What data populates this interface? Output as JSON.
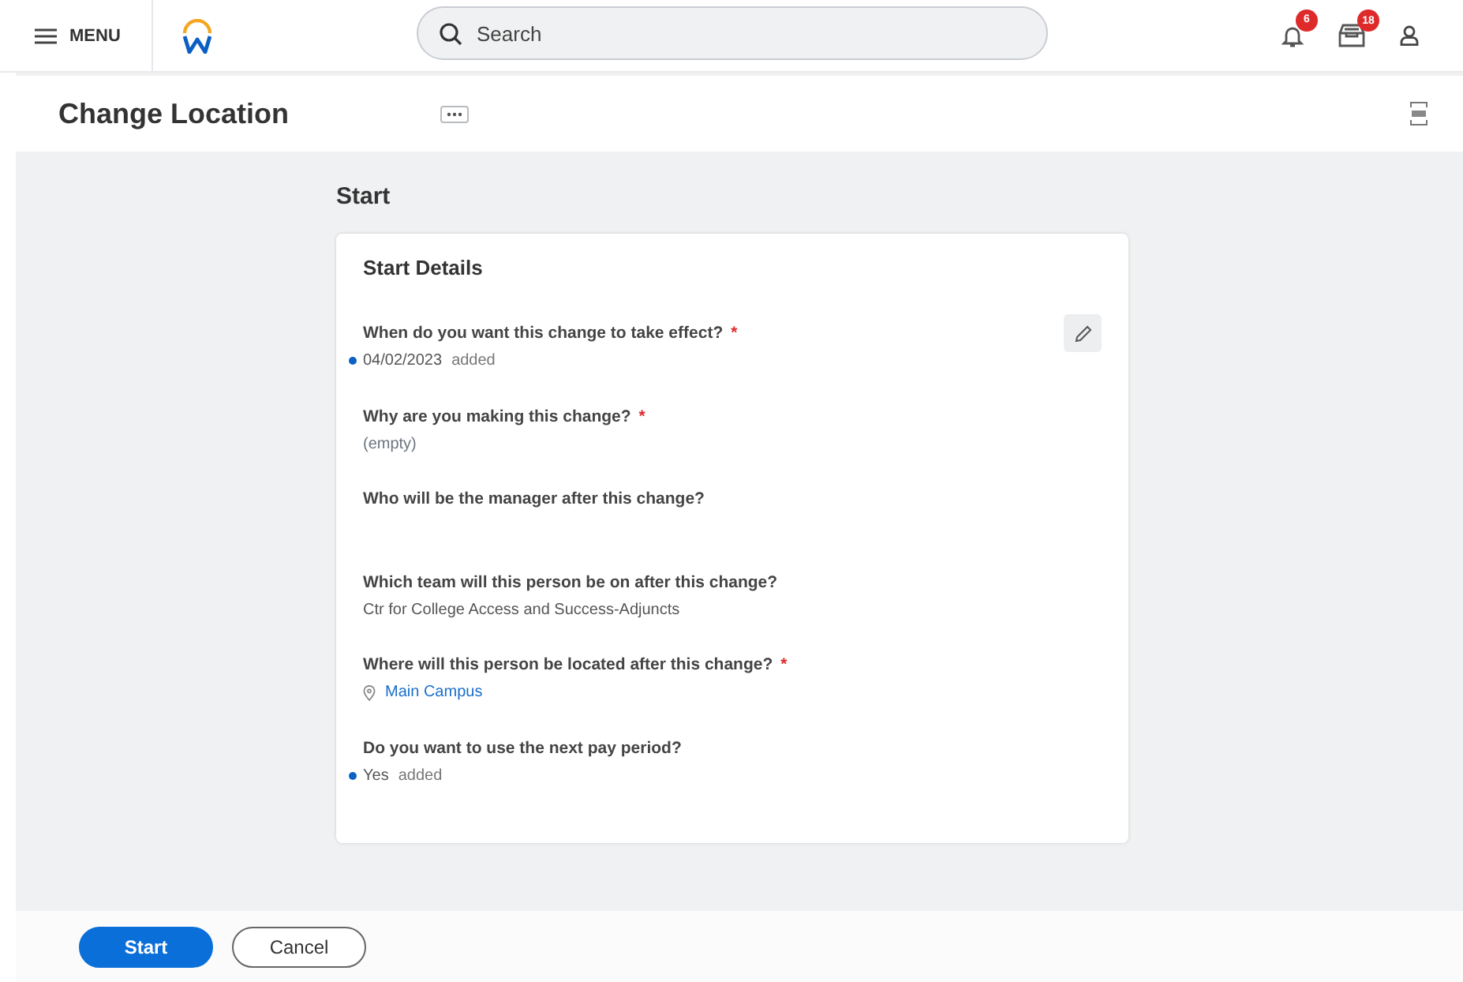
{
  "header": {
    "menu_label": "MENU",
    "search": {
      "placeholder": "Search"
    },
    "notifications_count": "6",
    "inbox_count": "18"
  },
  "title_bar": {
    "title": "Change Location"
  },
  "section": {
    "heading": "Start"
  },
  "card": {
    "title": "Start Details",
    "fields": [
      {
        "label": "When do you want this change to take effect?",
        "required_mark": "*",
        "value": "04/02/2023",
        "kind": "plain",
        "changed": true,
        "note": "added"
      },
      {
        "label": "Why are you making this change?",
        "required_mark": "*",
        "value": "(empty)",
        "kind": "muted",
        "changed": false
      },
      {
        "label": "Who will be the manager after this change?",
        "kind": "blank",
        "changed": false
      },
      {
        "label": "Which team will this person be on after this change?",
        "value": "Ctr for College Access and Success-Adjuncts",
        "kind": "plain",
        "changed": false
      },
      {
        "label": "Where will this person be located after this change?",
        "required_mark": "*",
        "value": "Main Campus",
        "kind": "location",
        "changed": false
      },
      {
        "label": "Do you want to use the next pay period?",
        "value": "Yes",
        "kind": "plain",
        "changed": true,
        "note": "added"
      }
    ]
  },
  "footer": {
    "buttons": [
      {
        "label": "Start",
        "kind": "primary"
      },
      {
        "label": "Cancel",
        "kind": "secondary"
      }
    ]
  }
}
